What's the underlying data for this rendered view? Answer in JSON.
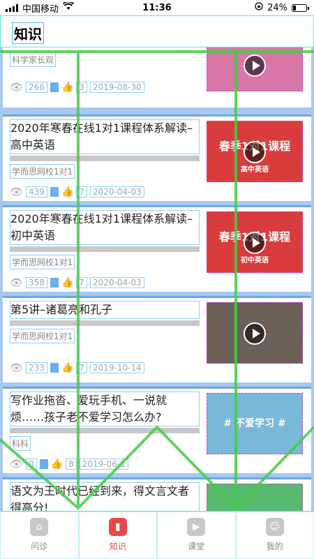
{
  "statusbar": {
    "carrier": "中国移动",
    "time": "11:36",
    "battery": "24%",
    "battery_level": 0.24
  },
  "header": {
    "title": "知识"
  },
  "cards": [
    {
      "title": "",
      "source": "科学家长观",
      "views": "266",
      "likes": "3",
      "date": "2019-08-30",
      "thumb_caption": "",
      "thumb_bg": "#d878a8"
    },
    {
      "title": "2020年寒春在线1对1课程体系解读–高中英语",
      "source": "学而思网校1对1",
      "views": "439",
      "likes": "7",
      "date": "2020-04-03",
      "thumb_caption": "春季1对1课程",
      "thumb_sub": "高中英语",
      "thumb_bg": "#d83c3c"
    },
    {
      "title": "2020年寒春在线1对1课程体系解读–初中英语",
      "source": "学而思网校1对1",
      "views": "358",
      "likes": "7",
      "date": "2020-04-03",
      "thumb_caption": "春季1对1课程",
      "thumb_sub": "初中英语",
      "thumb_bg": "#d83c3c"
    },
    {
      "title": "第5讲–诸葛亮和孔子",
      "source": "学而思网校1对1",
      "views": "233",
      "likes": "7",
      "date": "2019-10-14",
      "thumb_caption": "",
      "thumb_bg": "#6a6058"
    },
    {
      "title": "写作业拖沓、爱玩手机、一说就烦……孩子老不爱学习怎么办?",
      "source": "科科",
      "views": "0",
      "likes": "8",
      "date": "2019-06-1",
      "thumb_caption": "# 不爱学习 #",
      "thumb_bg": "#7ab8d8"
    },
    {
      "title": "语文为王时代已经到来，得文言文者得高分!",
      "source": "",
      "views": "",
      "likes": "",
      "date": "",
      "thumb_caption": "",
      "thumb_bg": "#58b870"
    }
  ],
  "tabs": [
    {
      "label": "问诊",
      "icon": "home-icon"
    },
    {
      "label": "知识",
      "icon": "book-icon"
    },
    {
      "label": "课堂",
      "icon": "video-icon"
    },
    {
      "label": "我的",
      "icon": "profile-icon"
    }
  ],
  "colors": {
    "accent": "#e84848",
    "overlay_line": "#44cc44"
  }
}
